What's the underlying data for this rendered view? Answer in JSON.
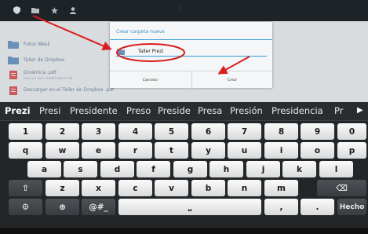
{
  "action_bar": {
    "icons": [
      "shield-icon",
      "folder-icon",
      "star-icon",
      "user-icon"
    ],
    "overflow_label": "⋮"
  },
  "file_list": {
    "rows": [
      {
        "name": "Fotos Wesli",
        "subtitle": ""
      },
      {
        "name": "Taller de Dropbox",
        "subtitle": ""
      },
      {
        "name": "Dinámica .pdf",
        "subtitle": "hace un mes, modificado el día"
      },
      {
        "name": "Descargar en el Taller de Dropbox .pdf",
        "subtitle": ""
      }
    ]
  },
  "dialog": {
    "title": "Crear carpeta nueva",
    "field_value": "Taller Prezi",
    "cancel_label": "Cancelar",
    "ok_label": "Crear"
  },
  "keyboard": {
    "suggestions": [
      "Prezi",
      "Presi",
      "Presidente",
      "Preso",
      "Preside",
      "Presa",
      "Presión",
      "Presidencia",
      "Pr"
    ],
    "more_arrow": "▶",
    "row_numbers": [
      "1",
      "2",
      "3",
      "4",
      "5",
      "6",
      "7",
      "8",
      "9",
      "0"
    ],
    "row_q": [
      "q",
      "w",
      "e",
      "r",
      "t",
      "y",
      "u",
      "i",
      "o",
      "p"
    ],
    "row_a": [
      "a",
      "s",
      "d",
      "f",
      "g",
      "h",
      "j",
      "k",
      "l"
    ],
    "row_z": [
      "z",
      "x",
      "c",
      "v",
      "b",
      "n",
      "m"
    ],
    "shift_label": "⇧",
    "backspace_label": "⌫",
    "settings_label": "⚙",
    "globe_label": "⊕",
    "symbols_label": "@#_",
    "space_label": "⎵",
    "comma_label": ",",
    "period_label": ".",
    "done_label": "Hecho"
  },
  "colors": {
    "accent": "#3d93c4",
    "annotation_red": "#d81e1e",
    "keyboard_bg": "#232628"
  }
}
